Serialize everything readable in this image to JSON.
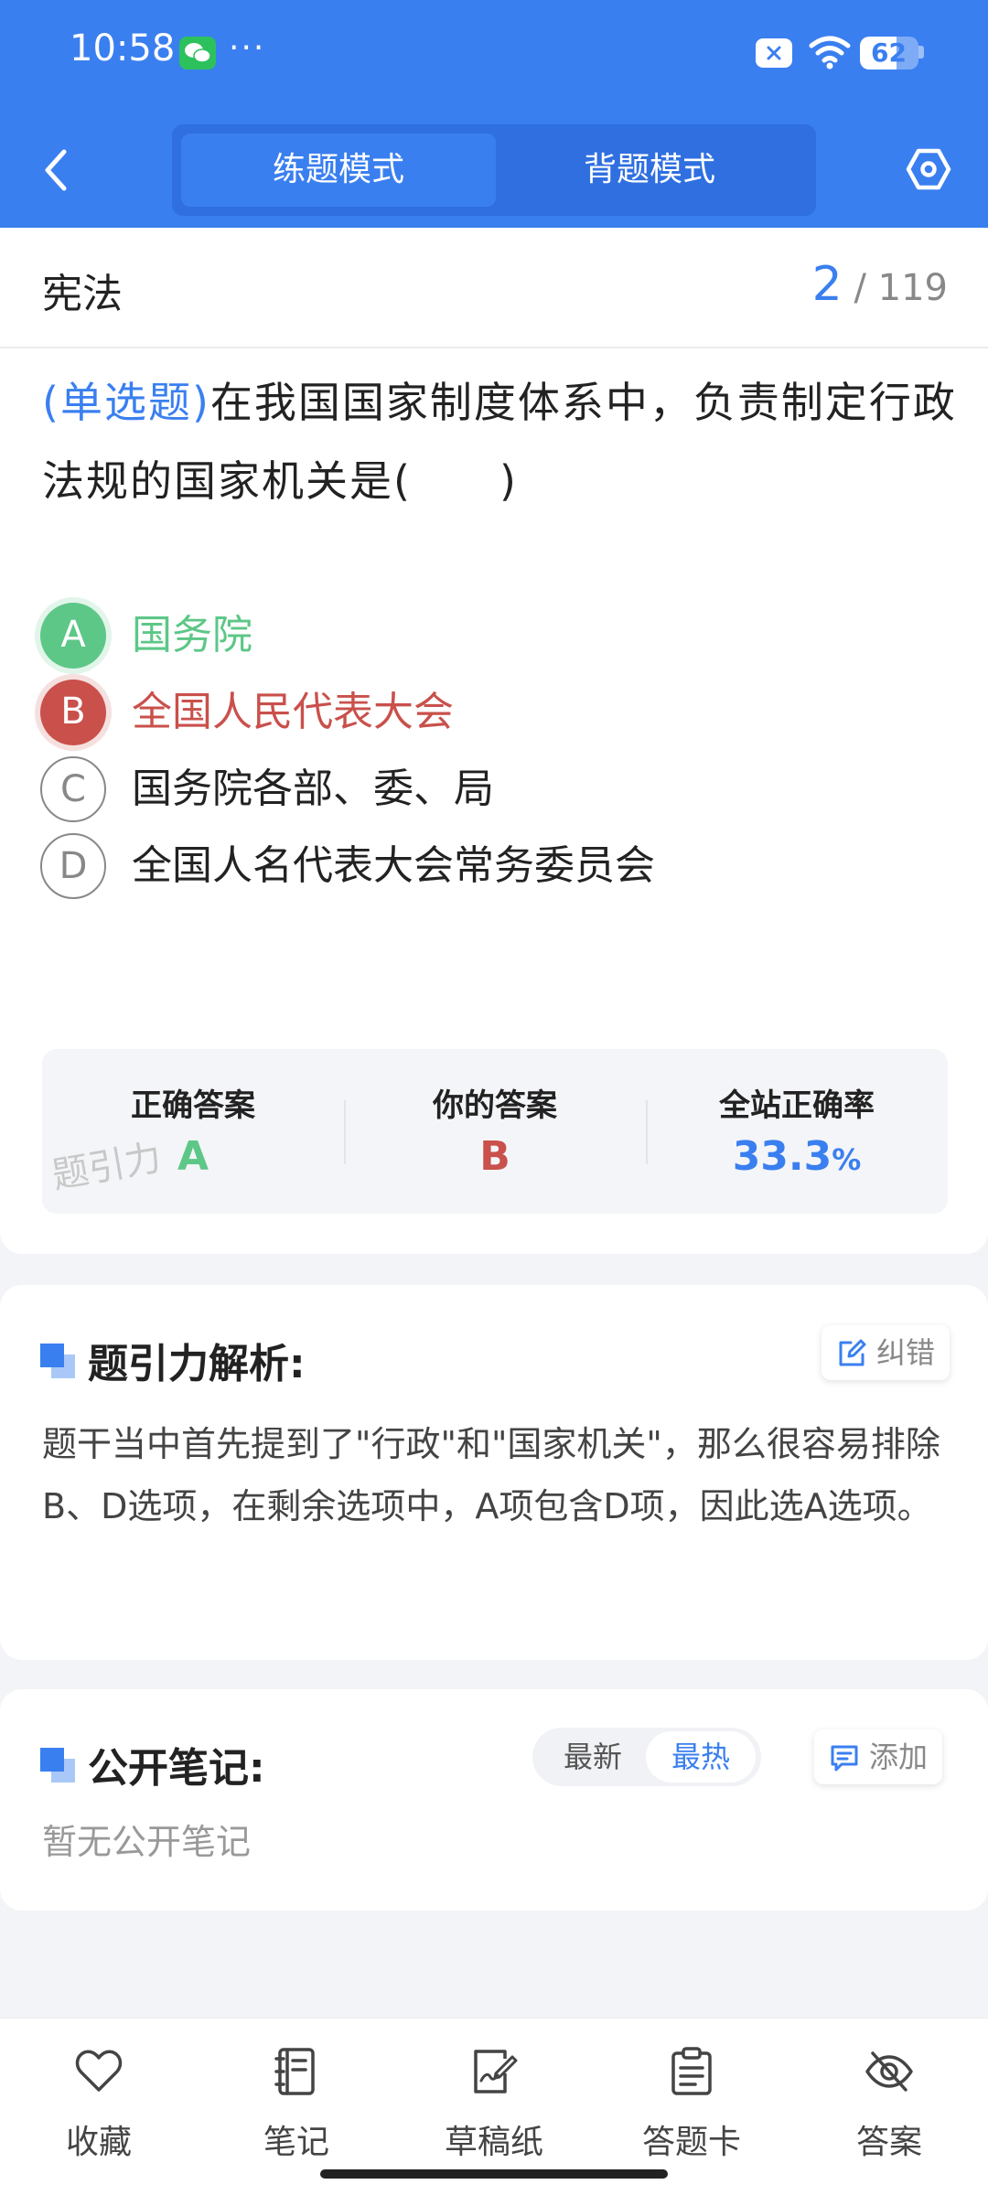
{
  "status_bar": {
    "time": "10:58",
    "dots": "···",
    "battery_level": 62,
    "battery_text": "62"
  },
  "header": {
    "mode_practice": "练题模式",
    "mode_memorize": "背题模式"
  },
  "question_card": {
    "subject": "宪法",
    "progress_current": "2",
    "progress_total": "/ 119",
    "question_type": "(单选题)",
    "question_text": "在我国国家制度体系中，负责制定行政法规的国家机关是(　　)",
    "options": [
      {
        "letter": "A",
        "text": "国务院",
        "state": "correct"
      },
      {
        "letter": "B",
        "text": "全国人民代表大会",
        "state": "wrong"
      },
      {
        "letter": "C",
        "text": "国务院各部、委、局",
        "state": "normal"
      },
      {
        "letter": "D",
        "text": "全国人名代表大会常务委员会",
        "state": "normal"
      }
    ],
    "result": {
      "correct_label": "正确答案",
      "correct_value": "A",
      "yours_label": "你的答案",
      "yours_value": "B",
      "rate_label": "全站正确率",
      "rate_value": "33.3",
      "rate_unit": "%"
    },
    "watermark": "题引力"
  },
  "analysis": {
    "title": "题引力解析:",
    "report_label": "纠错",
    "text": "题干当中首先提到了\"行政\"和\"国家机关\"，那么很容易排除B、D选项，在剩余选项中，A项包含D项，因此选A选项。"
  },
  "notes": {
    "title": "公开笔记:",
    "sort_latest": "最新",
    "sort_hot": "最热",
    "add_label": "添加",
    "empty_text": "暂无公开笔记"
  },
  "bottom_bar": {
    "tabs": [
      {
        "label": "收藏",
        "icon": "heart-icon"
      },
      {
        "label": "笔记",
        "icon": "notebook-icon"
      },
      {
        "label": "草稿纸",
        "icon": "scratch-paper-icon"
      },
      {
        "label": "答题卡",
        "icon": "answer-sheet-icon"
      },
      {
        "label": "答案",
        "icon": "eye-off-icon"
      }
    ]
  },
  "colors": {
    "primary": "#3a7ff0",
    "correct": "#5dc787",
    "wrong": "#c9504b"
  }
}
